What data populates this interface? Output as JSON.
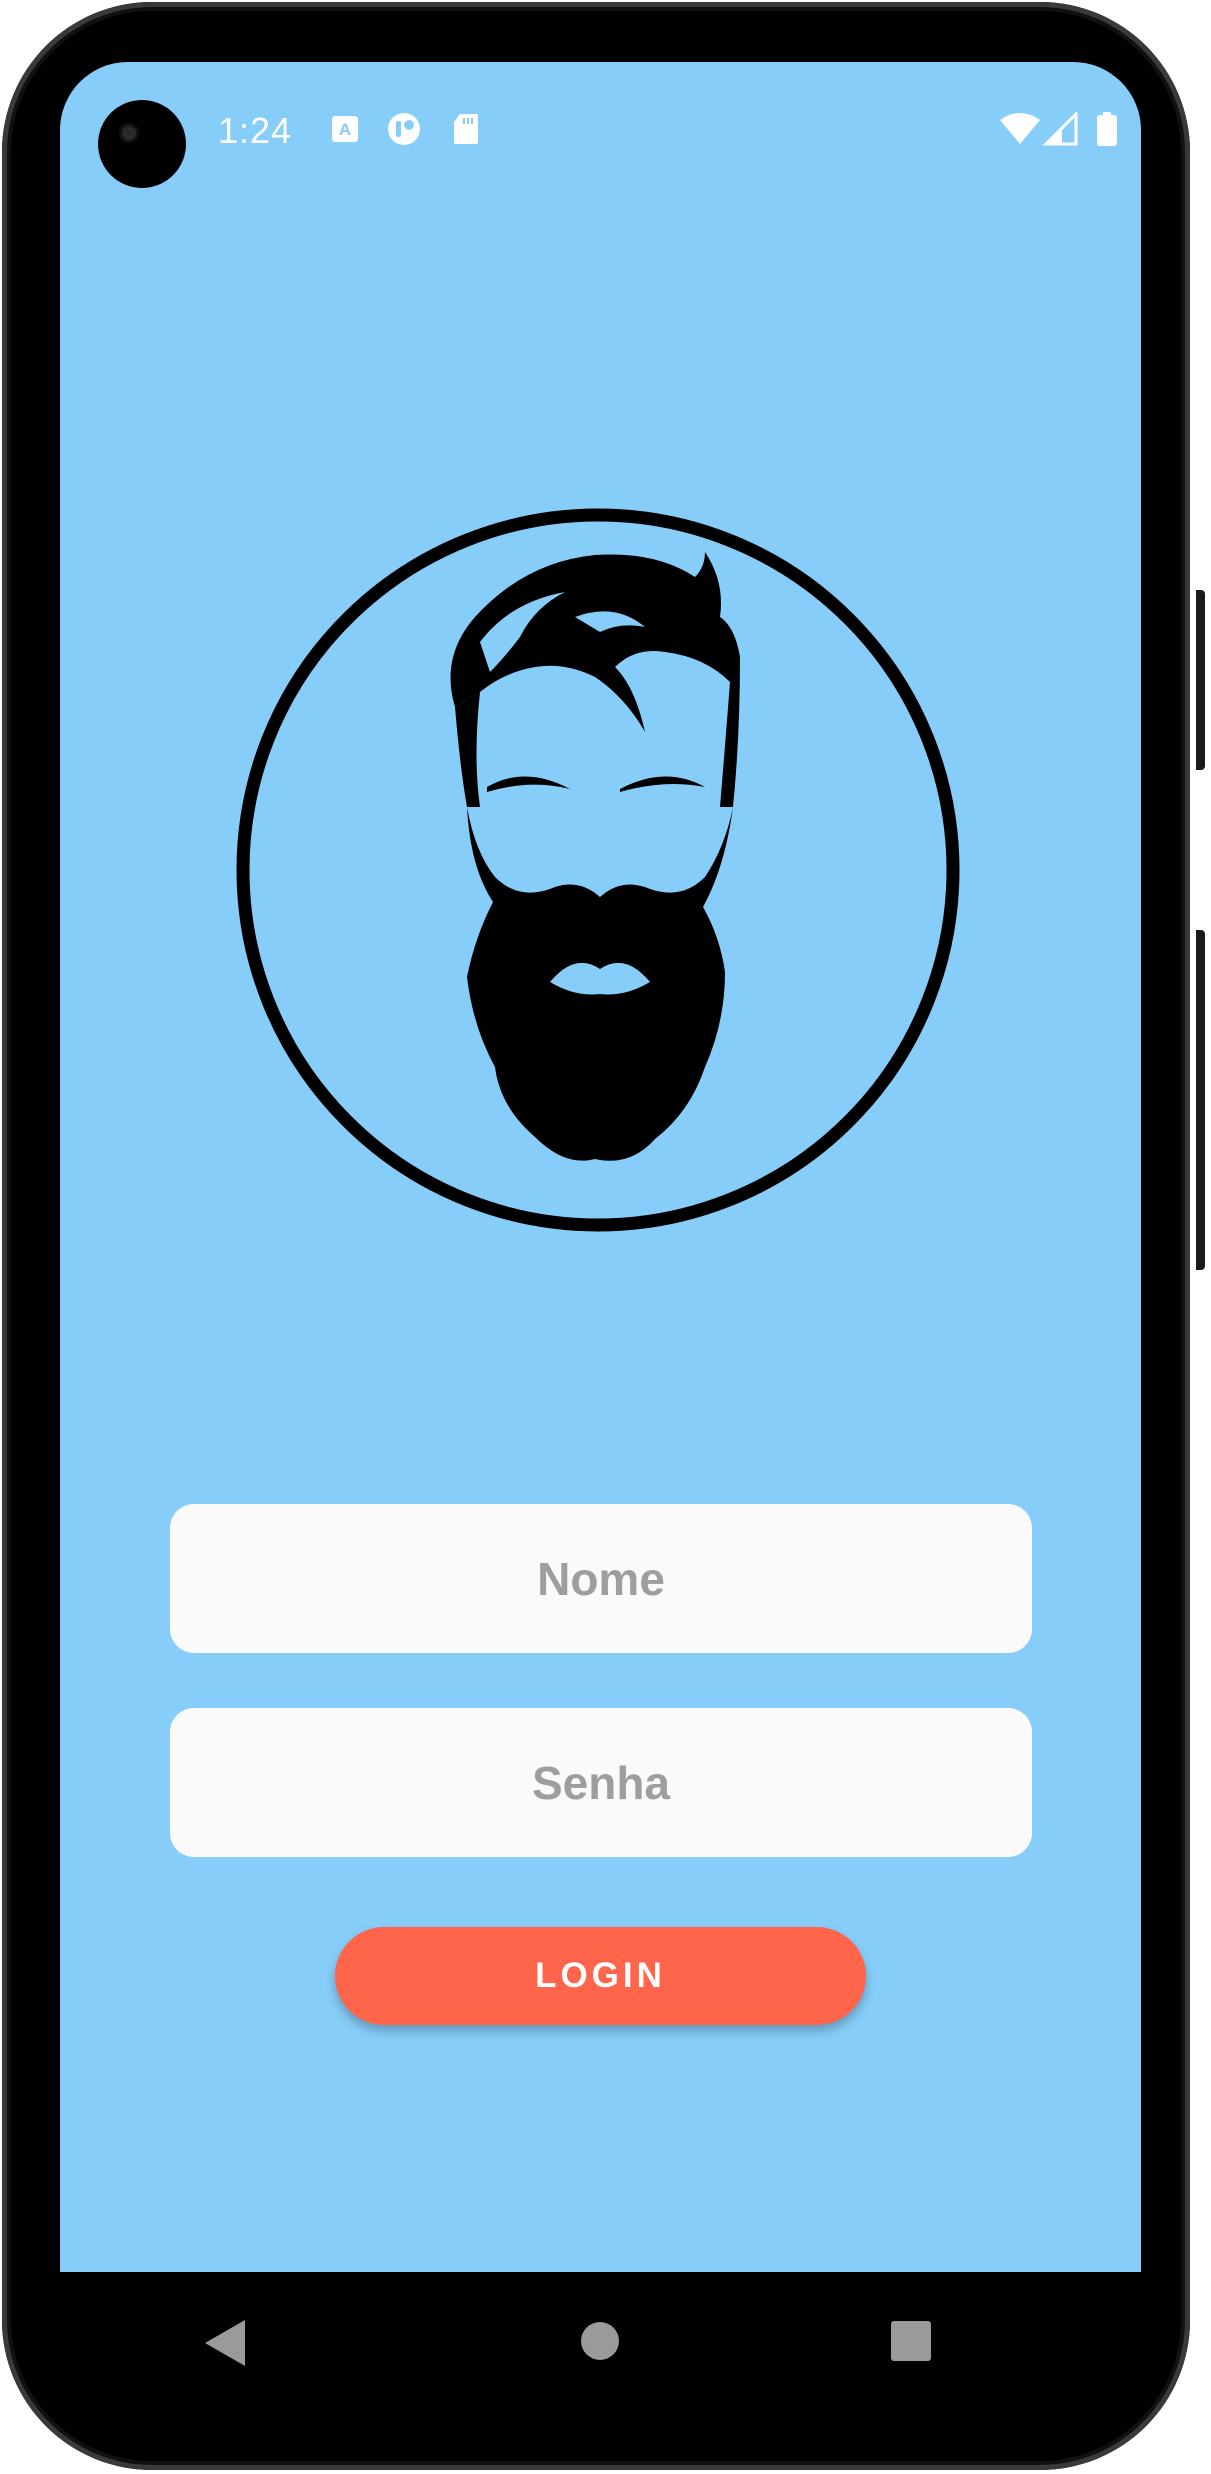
{
  "status_bar": {
    "time": "1:24",
    "icons": [
      "a-letter-icon",
      "app-circle-icon",
      "sd-card-icon",
      "wifi-icon",
      "cell-signal-icon",
      "battery-icon"
    ]
  },
  "logo": {
    "icon": "bearded-man-icon"
  },
  "form": {
    "name_placeholder": "Nome",
    "password_placeholder": "Senha",
    "login_label": "LOGIN"
  },
  "navigation": {
    "icons": [
      "back-icon",
      "home-icon",
      "recents-icon"
    ]
  },
  "colors": {
    "background": "#87cdf9",
    "field": "#fafafa",
    "placeholder": "#9e9e9e",
    "button": "#fe654a",
    "button_text": "#ffffff"
  }
}
